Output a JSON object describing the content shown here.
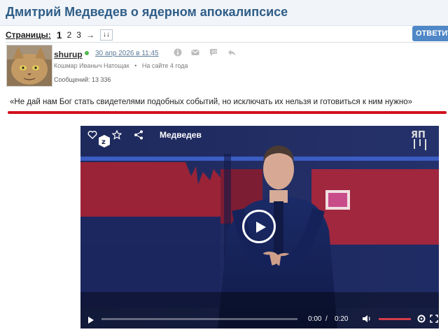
{
  "page": {
    "title": "Дмитрий Медведев о ядерном апокалипсисе",
    "pages_label": "Страницы:",
    "pages": [
      "1",
      "2",
      "3"
    ],
    "next_arrow": "→",
    "all_pages": "↓↓",
    "reply_button": "ОТВЕТИТ"
  },
  "post": {
    "username": "shurup",
    "date": "30 апр 2026 в 11:45",
    "signature": "Кошмар Иваныч Натощак",
    "on_site": "На сайте 4 года",
    "messages": "Сообщений: 13 336",
    "quote": "«Не дай нам Бог стать свидетелями подобных событий, но исключать их нельзя и готовиться к ним нужно»"
  },
  "video": {
    "title": "Медведев",
    "current_time": "0:00",
    "separator": "/",
    "duration": "0:20",
    "progress": 0
  },
  "colors": {
    "title": "#2e5d88",
    "reply_button": "#4f87c7",
    "underline": "#d2101c",
    "online": "#53b84b"
  },
  "icons": [
    "heart-icon",
    "z-logo-icon",
    "star-icon",
    "share-icon",
    "play-icon",
    "volume-icon",
    "settings-icon",
    "fullscreen-icon",
    "yap-logo-icon",
    "info-icon",
    "mail-icon",
    "quote-icon",
    "reply-icon"
  ]
}
